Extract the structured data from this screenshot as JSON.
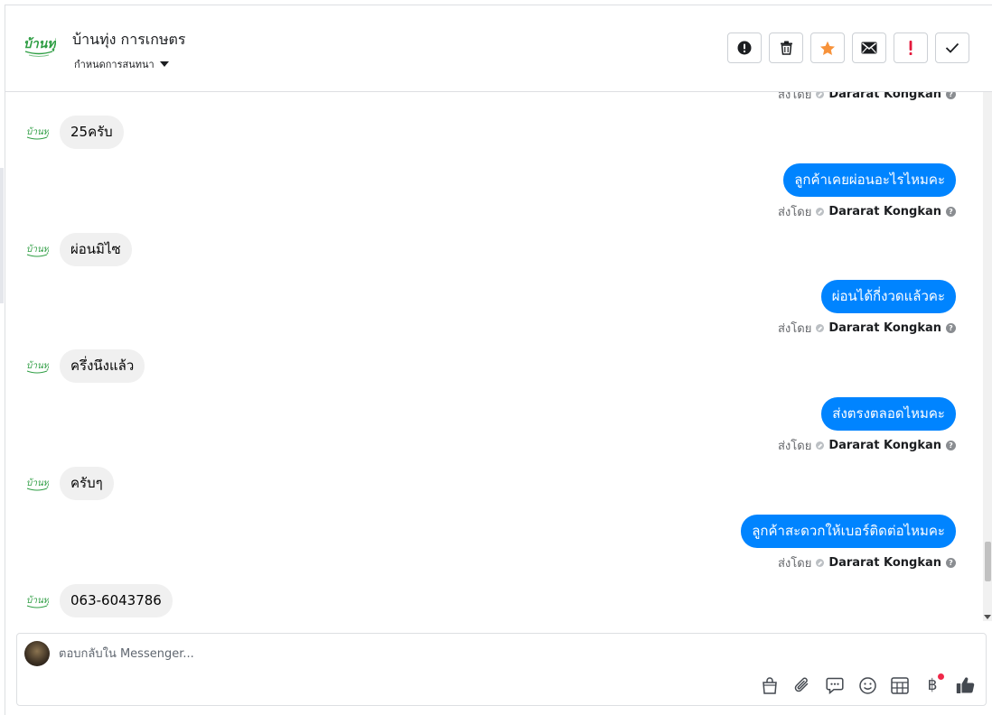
{
  "header": {
    "page_name": "บ้านทุ่ง การเกษตร",
    "conversation_settings_label": "กำหนดการสนทนา",
    "logo_text": "บ้านทุ่ง"
  },
  "actions": [
    {
      "icon": "exclamation-circle-icon"
    },
    {
      "icon": "trash-icon"
    },
    {
      "icon": "star-icon",
      "color": "#f7923a"
    },
    {
      "icon": "envelope-icon"
    },
    {
      "icon": "exclamation-icon",
      "color": "#e4193c"
    },
    {
      "icon": "checkmark-icon"
    }
  ],
  "thread": {
    "sent_by_label": "ส่งโดย",
    "agent_name": "Dararat Kongkan",
    "messages": [
      {
        "direction": "in",
        "text": "25ครับ"
      },
      {
        "direction": "out",
        "text": "ลูกค้าเคยผ่อนอะไรไหมคะ"
      },
      {
        "direction": "in",
        "text": "ผ่อนมิไซ"
      },
      {
        "direction": "out",
        "text": "ผ่อนได้กี่งวดแล้วคะ"
      },
      {
        "direction": "in",
        "text": "ครึ่งนึงแล้ว"
      },
      {
        "direction": "out",
        "text": "ส่งตรงตลอดไหมคะ"
      },
      {
        "direction": "in",
        "text": "ครับๆ"
      },
      {
        "direction": "out",
        "text": "ลูกค้าสะดวกให้เบอร์ติดต่อไหมคะ"
      },
      {
        "direction": "in",
        "text": "063-6043786"
      }
    ]
  },
  "composer": {
    "placeholder": "ตอบกลับใน Messenger...",
    "value": "",
    "tools": [
      "shopping-bag-icon",
      "paperclip-icon",
      "saved-reply-icon",
      "emoji-icon",
      "calculator-icon",
      "baht-icon",
      "like-icon"
    ],
    "baht_symbol": "฿"
  },
  "colors": {
    "outgoing_bubble": "#0084ff",
    "incoming_bubble": "#f0f0f0",
    "brand_green": "#2f9e44"
  }
}
